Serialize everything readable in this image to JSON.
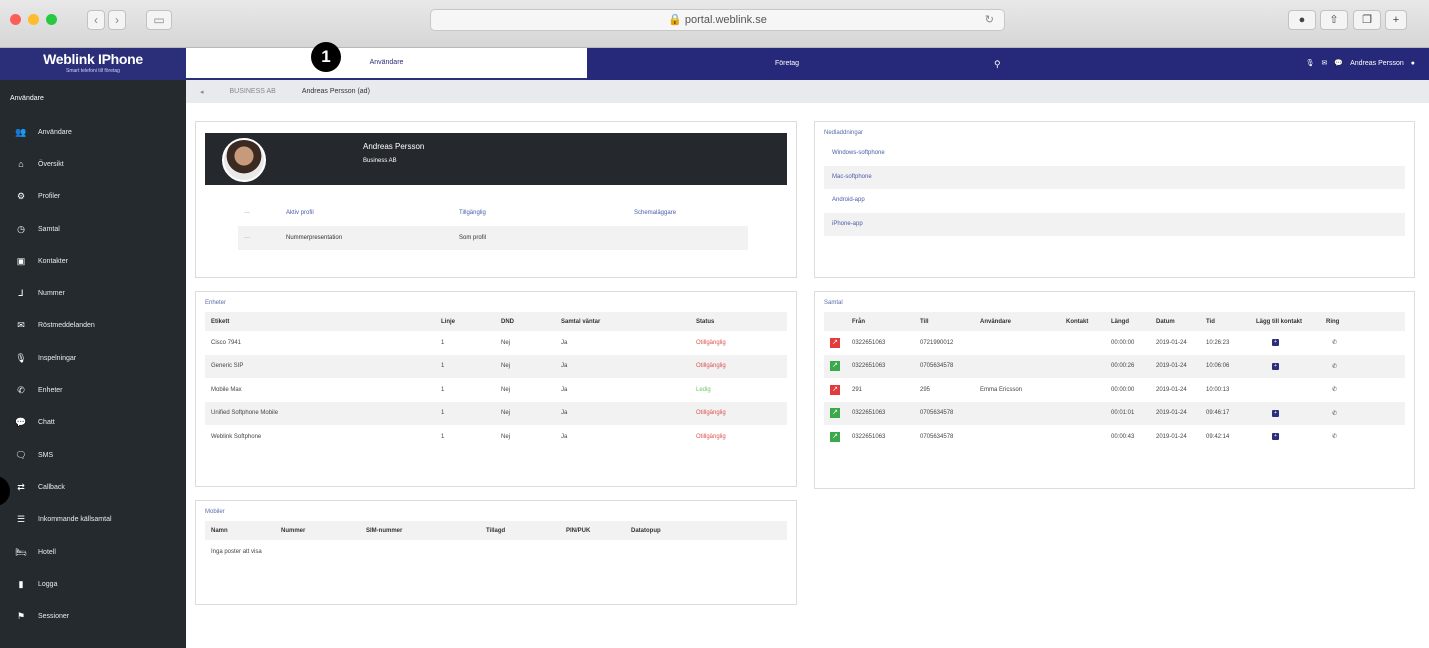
{
  "browser": {
    "url": "portal.weblink.se",
    "reload_icon": "reload-icon"
  },
  "sidebar": {
    "logo_title": "Weblink IPhone",
    "logo_sub": "Smart telefoni till företag",
    "heading": "Användare",
    "items": [
      {
        "label": "Användare",
        "icon": "users-icon",
        "glyph": "👥"
      },
      {
        "label": "Översikt",
        "icon": "home-icon",
        "glyph": "⌂"
      },
      {
        "label": "Profiler",
        "icon": "cogs-icon",
        "glyph": "⚙"
      },
      {
        "label": "Samtal",
        "icon": "clock-icon",
        "glyph": "◷"
      },
      {
        "label": "Kontakter",
        "icon": "contact-icon",
        "glyph": "▣"
      },
      {
        "label": "Nummer",
        "icon": "number-icon",
        "glyph": "⅃"
      },
      {
        "label": "Röstmeddelanden",
        "icon": "voicemail-icon",
        "glyph": "✉"
      },
      {
        "label": "Inspelningar",
        "icon": "microphone-icon",
        "glyph": "🎙"
      },
      {
        "label": "Enheter",
        "icon": "phone-icon",
        "glyph": "✆"
      },
      {
        "label": "Chatt",
        "icon": "chat-icon",
        "glyph": "💬"
      },
      {
        "label": "SMS",
        "icon": "sms-icon",
        "glyph": "🗨"
      },
      {
        "label": "Callback",
        "icon": "callback-icon",
        "glyph": "⇄"
      },
      {
        "label": "Inkommande källsamtal",
        "icon": "list-icon",
        "glyph": "☰"
      },
      {
        "label": "Hotell",
        "icon": "bed-icon",
        "glyph": "🛏"
      },
      {
        "label": "Logga",
        "icon": "book-icon",
        "glyph": "▮"
      },
      {
        "label": "Sessioner",
        "icon": "sitemap-icon",
        "glyph": "⚑"
      }
    ]
  },
  "topnav": {
    "tab_users": "Användare",
    "tab_company": "Företag",
    "search_icon": "search-icon",
    "user_name": "Andreas Persson",
    "marker": "1"
  },
  "breadcrumb": {
    "back_icon": "back-arrow-icon",
    "company": "BUSINESS AB",
    "current": "Andreas Persson (ad)"
  },
  "profile": {
    "name": "Andreas Persson",
    "company": "Business AB",
    "rows": [
      {
        "c1": "Aktiv profil",
        "c2": "Tillgänglig",
        "c3": "Schemaläggare"
      },
      {
        "c1": "Nummerpresentation",
        "c2": "Som profil",
        "c3": ""
      }
    ]
  },
  "downloads": {
    "title": "Nedladdningar",
    "items": [
      "Windows-softphone",
      "Mac-softphone",
      "Android-app",
      "iPhone-app"
    ]
  },
  "devices": {
    "title": "Enheter",
    "columns": [
      "Etikett",
      "Linje",
      "DND",
      "Samtal väntar",
      "Status"
    ],
    "rows": [
      [
        "Cisco 7941",
        "1",
        "Nej",
        "Ja",
        "Otillgänglig"
      ],
      [
        "Generic SIP",
        "1",
        "Nej",
        "Ja",
        "Otillgänglig"
      ],
      [
        "Mobile Max",
        "1",
        "Nej",
        "Ja",
        "Ledig"
      ],
      [
        "Unified Softphone Mobile",
        "1",
        "Nej",
        "Ja",
        "Otillgänglig"
      ],
      [
        "Weblink Softphone",
        "1",
        "Nej",
        "Ja",
        "Otillgänglig"
      ]
    ]
  },
  "mobiles": {
    "title": "Mobiler",
    "columns": [
      "Namn",
      "Nummer",
      "SIM-nummer",
      "Tillagd",
      "PIN/PUK",
      "Datatopup"
    ],
    "empty": "Inga poster att visa"
  },
  "calls": {
    "title": "Samtal",
    "columns": [
      "Från",
      "Till",
      "Användare",
      "Kontakt",
      "Längd",
      "Datum",
      "Tid",
      "Lägg till kontakt",
      "Ring"
    ],
    "rows": [
      {
        "dir": "out",
        "from": "0322651063",
        "to": "0721990012",
        "user": "",
        "contact": "",
        "len": "00:00:00",
        "date": "2019-01-24",
        "time": "10:26:23",
        "add": true
      },
      {
        "dir": "in",
        "from": "0322651063",
        "to": "0705634578",
        "user": "",
        "contact": "",
        "len": "00:00:26",
        "date": "2019-01-24",
        "time": "10:06:06",
        "add": true
      },
      {
        "dir": "out",
        "from": "291",
        "to": "295",
        "user": "Emma Ericsson",
        "contact": "",
        "len": "00:00:00",
        "date": "2019-01-24",
        "time": "10:00:13",
        "add": false
      },
      {
        "dir": "in",
        "from": "0322651063",
        "to": "0705634578",
        "user": "",
        "contact": "",
        "len": "00:01:01",
        "date": "2019-01-24",
        "time": "09:46:17",
        "add": true
      },
      {
        "dir": "in",
        "from": "0322651063",
        "to": "0705634578",
        "user": "",
        "contact": "",
        "len": "00:00:43",
        "date": "2019-01-24",
        "time": "09:42:14",
        "add": true
      }
    ]
  },
  "colors": {
    "nav": "#26297a",
    "sidebar": "#252a2e",
    "unavailable": "#d9534f",
    "available": "#6cc56c",
    "call_out": "#e23b3b",
    "call_in": "#3aa84b"
  }
}
